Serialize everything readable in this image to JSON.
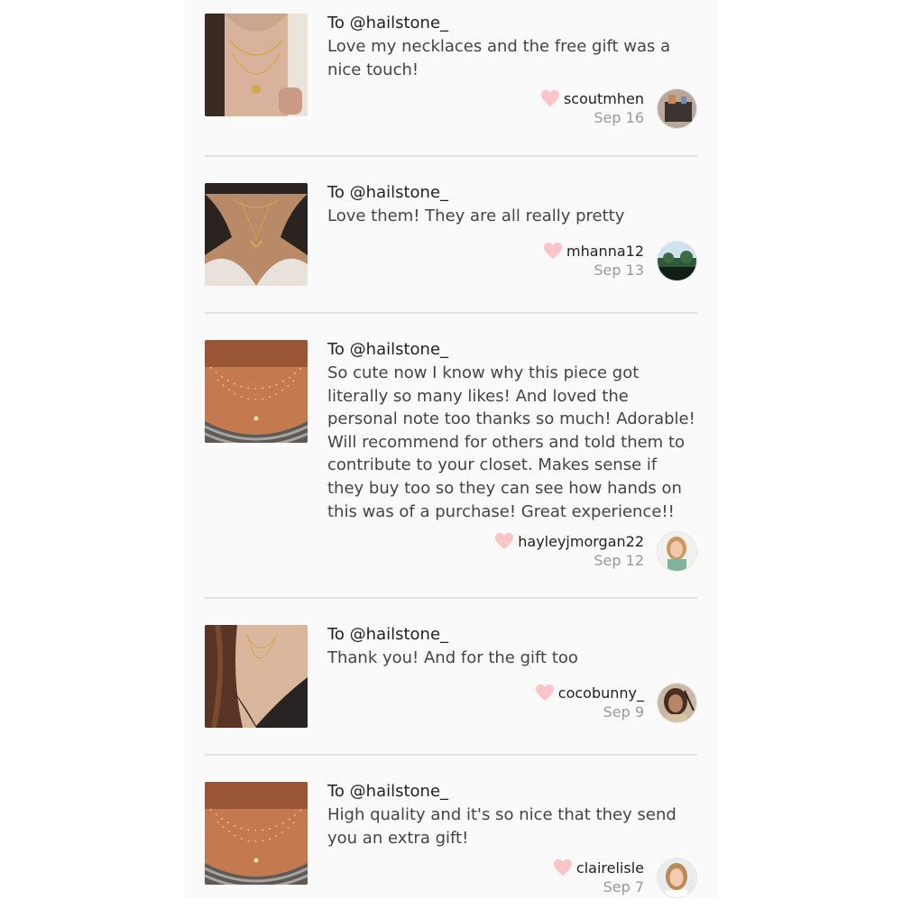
{
  "reviews": [
    {
      "to": "To @hailstone_",
      "message": "Love my necklaces and the free gift was a nice touch!",
      "username": "scoutmhen",
      "date": "Sep 16",
      "thumb": "necklace-photo-1",
      "avatar": "avatar-scoutmhen"
    },
    {
      "to": "To @hailstone_",
      "message": "Love them! They are all really pretty",
      "username": "mhanna12",
      "date": "Sep 13",
      "thumb": "necklace-photo-2",
      "avatar": "avatar-mhanna12"
    },
    {
      "to": "To @hailstone_",
      "message": "So cute now I know why this piece got literally so many likes! And loved the personal note too thanks so much! Adorable! Will recommend for others and told them to contribute to your closet. Makes sense if they buy too so they can see how hands on this was of a purchase! Great experience!!",
      "username": "hayleyjmorgan22",
      "date": "Sep 12",
      "thumb": "necklace-photo-3",
      "avatar": "avatar-hayleyjmorgan22"
    },
    {
      "to": "To @hailstone_",
      "message": "Thank you! And for the gift too",
      "username": "cocobunny_",
      "date": "Sep 9",
      "thumb": "necklace-photo-4",
      "avatar": "avatar-cocobunny"
    },
    {
      "to": "To @hailstone_",
      "message": "High quality and it's so nice that they send you an extra gift!",
      "username": "clairelisle",
      "date": "Sep 7",
      "thumb": "necklace-photo-5",
      "avatar": "avatar-clairelisle"
    }
  ],
  "colors": {
    "heart": "#f9c5c8",
    "divider": "#e2e2e2",
    "panel": "#fafafa",
    "date": "#999999"
  },
  "icons": {
    "like": "heart-icon"
  }
}
